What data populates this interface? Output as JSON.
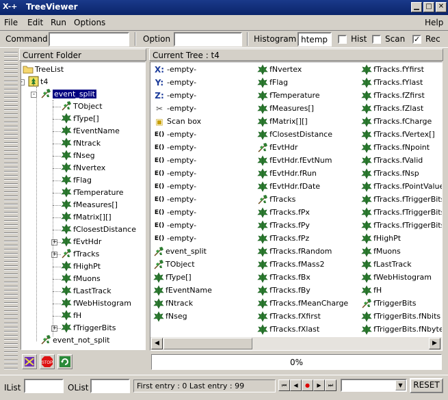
{
  "window": {
    "title": "TreeViewer",
    "sys_icon": "X-+"
  },
  "menubar": {
    "items": [
      "File",
      "Edit",
      "Run",
      "Options"
    ],
    "help": "Help"
  },
  "toolbar": {
    "command_label": "Command",
    "command_value": "",
    "option_label": "Option",
    "option_value": "",
    "histogram_label": "Histogram",
    "histogram_value": "htemp",
    "hist_label": "Hist",
    "hist_checked": false,
    "scan_label": "Scan",
    "scan_checked": false,
    "rec_label": "Rec",
    "rec_checked": true
  },
  "left_panel": {
    "header": "Current Folder",
    "tree": [
      {
        "label": "TreeList",
        "icon": "folder-icon",
        "depth": 0
      },
      {
        "label": "t4",
        "icon": "tree-icon",
        "depth": 1,
        "expander": "-"
      },
      {
        "label": "event_split",
        "icon": "branch-icon",
        "depth": 2,
        "expander": "-",
        "selected": true
      },
      {
        "label": "TObject",
        "icon": "branch-icon",
        "depth": 3
      },
      {
        "label": "fType[]",
        "icon": "leaf-icon",
        "depth": 3
      },
      {
        "label": "fEventName",
        "icon": "leaf-icon",
        "depth": 3
      },
      {
        "label": "fNtrack",
        "icon": "leaf-icon",
        "depth": 3
      },
      {
        "label": "fNseg",
        "icon": "leaf-icon",
        "depth": 3
      },
      {
        "label": "fNvertex",
        "icon": "leaf-icon",
        "depth": 3
      },
      {
        "label": "fFlag",
        "icon": "leaf-icon",
        "depth": 3
      },
      {
        "label": "fTemperature",
        "icon": "leaf-icon",
        "depth": 3
      },
      {
        "label": "fMeasures[]",
        "icon": "leaf-icon",
        "depth": 3
      },
      {
        "label": "fMatrix[][]",
        "icon": "leaf-icon",
        "depth": 3
      },
      {
        "label": "fClosestDistance",
        "icon": "leaf-icon",
        "depth": 3
      },
      {
        "label": "fEvtHdr",
        "icon": "leaf-icon",
        "depth": 3,
        "expander": "+"
      },
      {
        "label": "fTracks",
        "icon": "branch-icon",
        "depth": 3,
        "expander": "+"
      },
      {
        "label": "fHighPt",
        "icon": "leaf-icon",
        "depth": 3
      },
      {
        "label": "fMuons",
        "icon": "leaf-icon",
        "depth": 3
      },
      {
        "label": "fLastTrack",
        "icon": "leaf-icon",
        "depth": 3
      },
      {
        "label": "fWebHistogram",
        "icon": "leaf-icon",
        "depth": 3
      },
      {
        "label": "fH",
        "icon": "leaf-icon",
        "depth": 3
      },
      {
        "label": "fTriggerBits",
        "icon": "leaf-icon",
        "depth": 3,
        "expander": "+"
      },
      {
        "label": "event_not_split",
        "icon": "branch-icon",
        "depth": 2
      }
    ]
  },
  "right_panel": {
    "header": "Current Tree : t4",
    "columns": [
      [
        {
          "icon": "x-axis-icon",
          "glyph": "X:",
          "label": "-empty-"
        },
        {
          "icon": "y-axis-icon",
          "glyph": "Y:",
          "label": "-empty-"
        },
        {
          "icon": "z-axis-icon",
          "glyph": "Z:",
          "label": "-empty-"
        },
        {
          "icon": "scissors-icon",
          "glyph": "✂",
          "label": "-empty-"
        },
        {
          "icon": "scan-box-icon",
          "glyph": "▣",
          "label": "Scan box"
        },
        {
          "icon": "expression-icon",
          "glyph": "E()",
          "label": "-empty-"
        },
        {
          "icon": "expression-icon",
          "glyph": "E()",
          "label": "-empty-"
        },
        {
          "icon": "expression-icon",
          "glyph": "E()",
          "label": "-empty-"
        },
        {
          "icon": "expression-icon",
          "glyph": "E()",
          "label": "-empty-"
        },
        {
          "icon": "expression-icon",
          "glyph": "E()",
          "label": "-empty-"
        },
        {
          "icon": "expression-icon",
          "glyph": "E()",
          "label": "-empty-"
        },
        {
          "icon": "expression-icon",
          "glyph": "E()",
          "label": "-empty-"
        },
        {
          "icon": "expression-icon",
          "glyph": "E()",
          "label": "-empty-"
        },
        {
          "icon": "expression-icon",
          "glyph": "E()",
          "label": "-empty-"
        },
        {
          "icon": "branch-icon",
          "glyph": "",
          "label": "event_split"
        },
        {
          "icon": "branch-icon",
          "glyph": "",
          "label": "TObject"
        },
        {
          "icon": "leaf-icon",
          "glyph": "",
          "label": "fType[]"
        },
        {
          "icon": "leaf-icon",
          "glyph": "",
          "label": "fEventName"
        },
        {
          "icon": "leaf-icon",
          "glyph": "",
          "label": "fNtrack"
        },
        {
          "icon": "leaf-icon",
          "glyph": "",
          "label": "fNseg"
        }
      ],
      [
        {
          "icon": "leaf-icon",
          "label": "fNvertex"
        },
        {
          "icon": "leaf-icon",
          "label": "fFlag"
        },
        {
          "icon": "leaf-icon",
          "label": "fTemperature"
        },
        {
          "icon": "leaf-icon",
          "label": "fMeasures[]"
        },
        {
          "icon": "leaf-icon",
          "label": "fMatrix[][]"
        },
        {
          "icon": "leaf-icon",
          "label": "fClosestDistance"
        },
        {
          "icon": "branch-icon",
          "label": "fEvtHdr"
        },
        {
          "icon": "leaf-icon",
          "label": "fEvtHdr.fEvtNum"
        },
        {
          "icon": "leaf-icon",
          "label": "fEvtHdr.fRun"
        },
        {
          "icon": "leaf-icon",
          "label": "fEvtHdr.fDate"
        },
        {
          "icon": "branch-icon",
          "label": "fTracks"
        },
        {
          "icon": "leaf-icon",
          "label": "fTracks.fPx"
        },
        {
          "icon": "leaf-icon",
          "label": "fTracks.fPy"
        },
        {
          "icon": "leaf-icon",
          "label": "fTracks.fPz"
        },
        {
          "icon": "leaf-icon",
          "label": "fTracks.fRandom"
        },
        {
          "icon": "leaf-icon",
          "label": "fTracks.fMass2"
        },
        {
          "icon": "leaf-icon",
          "label": "fTracks.fBx"
        },
        {
          "icon": "leaf-icon",
          "label": "fTracks.fBy"
        },
        {
          "icon": "leaf-icon",
          "label": "fTracks.fMeanCharge"
        },
        {
          "icon": "leaf-icon",
          "label": "fTracks.fXfirst"
        },
        {
          "icon": "leaf-icon",
          "label": "fTracks.fXlast"
        }
      ],
      [
        {
          "icon": "leaf-icon",
          "label": "fTracks.fYfirst"
        },
        {
          "icon": "leaf-icon",
          "label": "fTracks.fYlast"
        },
        {
          "icon": "leaf-icon",
          "label": "fTracks.fZfirst"
        },
        {
          "icon": "leaf-icon",
          "label": "fTracks.fZlast"
        },
        {
          "icon": "leaf-icon",
          "label": "fTracks.fCharge"
        },
        {
          "icon": "leaf-icon",
          "label": "fTracks.fVertex[]"
        },
        {
          "icon": "leaf-icon",
          "label": "fTracks.fNpoint"
        },
        {
          "icon": "leaf-icon",
          "label": "fTracks.fValid"
        },
        {
          "icon": "leaf-icon",
          "label": "fTracks.fNsp"
        },
        {
          "icon": "leaf-icon",
          "label": "fTracks.fPointValue"
        },
        {
          "icon": "leaf-icon",
          "label": "fTracks.fTriggerBits.fN"
        },
        {
          "icon": "leaf-icon",
          "label": "fTracks.fTriggerBits.fN"
        },
        {
          "icon": "leaf-icon",
          "label": "fTracks.fTriggerBits.fA"
        },
        {
          "icon": "leaf-icon",
          "label": "fHighPt"
        },
        {
          "icon": "leaf-icon",
          "label": "fMuons"
        },
        {
          "icon": "leaf-icon",
          "label": "fLastTrack"
        },
        {
          "icon": "leaf-icon",
          "label": "fWebHistogram"
        },
        {
          "icon": "leaf-icon",
          "label": "fH"
        },
        {
          "icon": "branch-icon",
          "label": "fTriggerBits"
        },
        {
          "icon": "leaf-icon",
          "label": "fTriggerBits.fNbits"
        },
        {
          "icon": "leaf-icon",
          "label": "fTriggerBits.fNbytes"
        }
      ]
    ],
    "progress_text": "0%",
    "progress": 0
  },
  "statusbar": {
    "ilist_label": "IList",
    "ilist_value": "",
    "olist_label": "OList",
    "olist_value": "",
    "entry_text": "First entry : 0 Last entry : 99",
    "reset_label": "RESET"
  },
  "colors": {
    "title_bg": "#0a246a",
    "selection_bg": "#000080",
    "leaf_green": "#2e7d32",
    "panel_bg": "#d4d0c8"
  }
}
